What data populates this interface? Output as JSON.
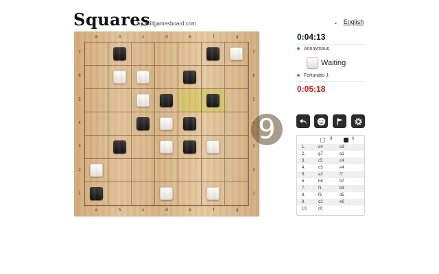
{
  "header": {
    "title": "Squares",
    "subtitle": "by skillgamesboard.com",
    "language": "English"
  },
  "board": {
    "files": [
      "a",
      "b",
      "c",
      "d",
      "e",
      "f",
      "g"
    ],
    "ranks": [
      "7",
      "6",
      "5",
      "4",
      "3",
      "2",
      "1"
    ],
    "pieces": [
      {
        "square": "b7",
        "color": "black"
      },
      {
        "square": "f7",
        "color": "black"
      },
      {
        "square": "g7",
        "color": "white"
      },
      {
        "square": "b6",
        "color": "white"
      },
      {
        "square": "c6",
        "color": "white"
      },
      {
        "square": "e6",
        "color": "black"
      },
      {
        "square": "c5",
        "color": "white"
      },
      {
        "square": "d5",
        "color": "black"
      },
      {
        "square": "f5",
        "color": "black"
      },
      {
        "square": "c4",
        "color": "black"
      },
      {
        "square": "d4",
        "color": "white"
      },
      {
        "square": "e4",
        "color": "black"
      },
      {
        "square": "b3",
        "color": "black"
      },
      {
        "square": "d3",
        "color": "white"
      },
      {
        "square": "e3",
        "color": "black"
      },
      {
        "square": "f3",
        "color": "white"
      },
      {
        "square": "a2",
        "color": "white"
      },
      {
        "square": "a1",
        "color": "black"
      },
      {
        "square": "d1",
        "color": "white"
      },
      {
        "square": "f1",
        "color": "white"
      }
    ],
    "highlight": [
      "e5",
      "f5"
    ],
    "overlay_number": "9"
  },
  "panel": {
    "clock_top": "0:04:13",
    "player_top": "Anonymous",
    "status": "Waiting",
    "player_bottom": "Fortunato J.",
    "clock_bottom": "0:05:18",
    "status_dot_color": "#3cb33c",
    "clock_bottom_color": "#e01010"
  },
  "toolbar": {
    "icons": [
      "undo-icon",
      "smiley-icon",
      "flag-icon",
      "gear-icon"
    ]
  },
  "moves": {
    "white_count": "9",
    "black_count": "0",
    "rows": [
      {
        "n": "1.",
        "w": "d4",
        "b": "e3"
      },
      {
        "n": "2.",
        "w": "g7",
        "b": "a1"
      },
      {
        "n": "3.",
        "w": "c5",
        "b": "c4"
      },
      {
        "n": "4.",
        "w": "d3",
        "b": "e4"
      },
      {
        "n": "5.",
        "w": "a2",
        "b": "f7"
      },
      {
        "n": "6.",
        "w": "b6",
        "b": "b7"
      },
      {
        "n": "7.",
        "w": "f1",
        "b": "b3"
      },
      {
        "n": "8.",
        "w": "f3",
        "b": "d5"
      },
      {
        "n": "9.",
        "w": "d1",
        "b": "e6"
      },
      {
        "n": "10.",
        "w": "c6",
        "b": ""
      }
    ]
  }
}
